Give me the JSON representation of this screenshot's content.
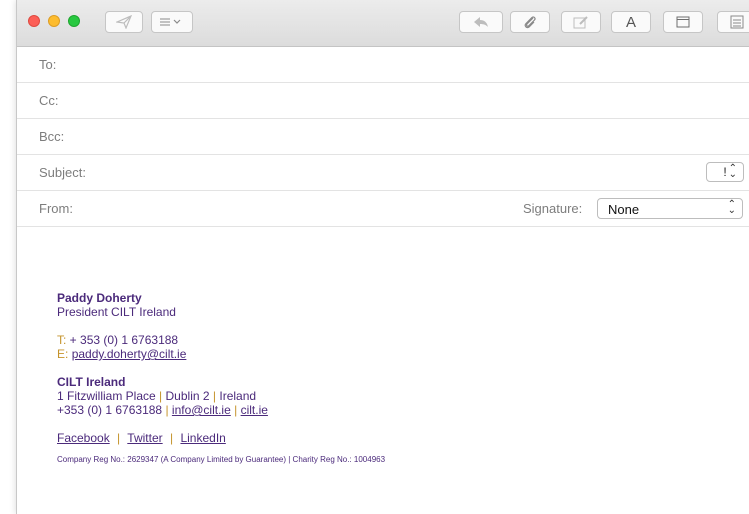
{
  "toolbar": {
    "buttons": [
      {
        "name": "send-icon"
      },
      {
        "name": "header-fields-menu-icon"
      },
      {
        "name": "reply-icon"
      },
      {
        "name": "attachment-icon"
      },
      {
        "name": "markup-icon"
      },
      {
        "name": "format-icon",
        "text": "A"
      },
      {
        "name": "browser-window-icon"
      },
      {
        "name": "photo-browser-icon"
      }
    ]
  },
  "fields": {
    "to_label": "To:",
    "cc_label": "Cc:",
    "bcc_label": "Bcc:",
    "subject_label": "Subject:",
    "priority_value": "!",
    "from_label": "From:",
    "signature_label": "Signature:",
    "signature_value": "None"
  },
  "signature": {
    "name": "Paddy Doherty",
    "title": "President CILT Ireland",
    "phone_prefix": "T:",
    "phone": " + 353 (0) 1 6763188",
    "email_prefix": "E:",
    "email": "paddy.doherty@cilt.ie",
    "org": "CILT Ireland",
    "address_1": "1 Fitzwilliam Place",
    "address_2": "Dublin 2",
    "address_3": "Ireland",
    "org_phone": "+353 (0) 1 6763188",
    "org_email": "info@cilt.ie",
    "org_site": "cilt.ie",
    "separator": "|",
    "social_facebook": "Facebook",
    "social_twitter": "Twitter",
    "social_linkedin": "LinkedIn",
    "legal": "Company Reg No.: 2629347 (A Company Limited by Guarantee) | Charity Reg No.: 1004963"
  },
  "colors": {
    "signature_purple": "#4b2a7b",
    "signature_gold": "#c5932b"
  }
}
